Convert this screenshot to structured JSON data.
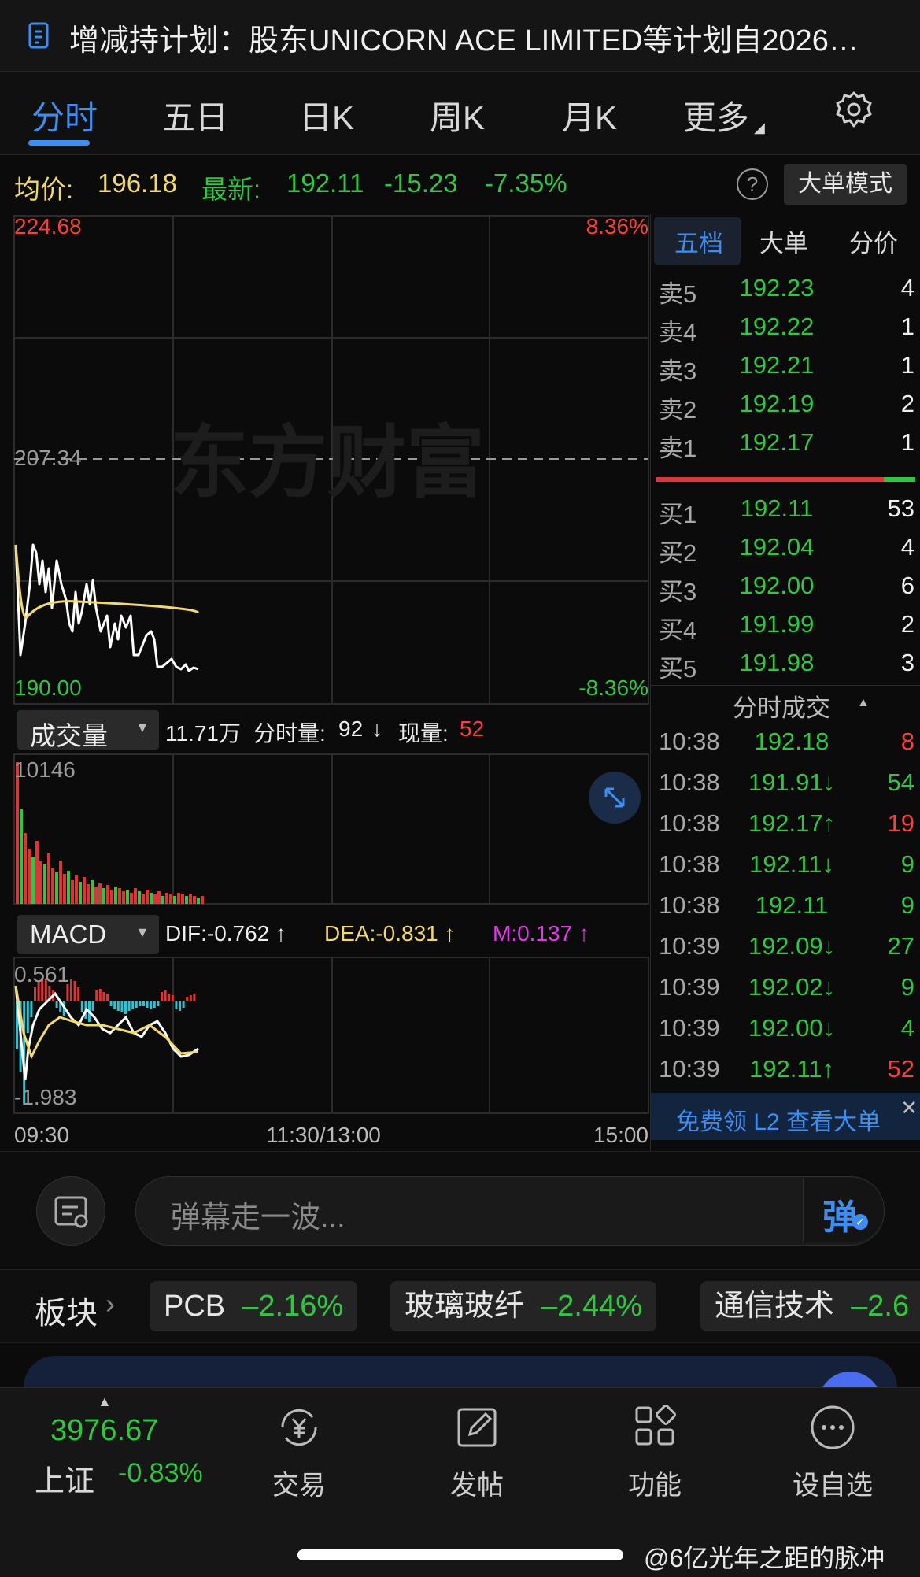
{
  "banner": {
    "text": "增减持计划：股东UNICORN ACE LIMITED等计划自2026…",
    "icon": "document-icon"
  },
  "tabs": [
    {
      "label": "分时",
      "active": true
    },
    {
      "label": "五日"
    },
    {
      "label": "日K"
    },
    {
      "label": "周K"
    },
    {
      "label": "月K"
    },
    {
      "label": "更多"
    }
  ],
  "settings_icon": "gear-icon",
  "info": {
    "avg_label": "均价:",
    "avg_value": "196.18",
    "latest_label": "最新:",
    "latest_value": "192.11",
    "change": "-15.23",
    "change_pct": "-7.35%",
    "help": "?",
    "big_order_mode": "大单模式"
  },
  "price_chart": {
    "high": "224.68",
    "high_pct": "8.36%",
    "prev_close": "207.34",
    "low": "190.00",
    "low_pct": "-8.36%",
    "watermark": "东方财富"
  },
  "volume": {
    "selector": "成交量",
    "total": "11.71万",
    "min_label": "分时量:",
    "min_value": "92",
    "min_arrow": "↓",
    "now_label": "现量:",
    "now_value": "52",
    "max": "10146"
  },
  "macd": {
    "selector": "MACD",
    "dif": "DIF:-0.762 ↑",
    "dea": "DEA:-0.831 ↑",
    "m": "M:0.137 ↑",
    "top": "0.561",
    "bottom": "-1.983"
  },
  "time_axis": [
    "09:30",
    "11:30/13:00",
    "15:00"
  ],
  "book": {
    "tabs": [
      "五档",
      "大单",
      "分价"
    ],
    "sells": [
      {
        "label": "卖5",
        "price": "192.23",
        "qty": "4"
      },
      {
        "label": "卖4",
        "price": "192.22",
        "qty": "1"
      },
      {
        "label": "卖3",
        "price": "192.21",
        "qty": "1"
      },
      {
        "label": "卖2",
        "price": "192.19",
        "qty": "2"
      },
      {
        "label": "卖1",
        "price": "192.17",
        "qty": "1"
      }
    ],
    "buys": [
      {
        "label": "买1",
        "price": "192.11",
        "qty": "53"
      },
      {
        "label": "买2",
        "price": "192.04",
        "qty": "4"
      },
      {
        "label": "买3",
        "price": "192.00",
        "qty": "6"
      },
      {
        "label": "买4",
        "price": "191.99",
        "qty": "2"
      },
      {
        "label": "买5",
        "price": "191.98",
        "qty": "3"
      }
    ],
    "trades_title": "分时成交",
    "trades": [
      {
        "time": "10:38",
        "price": "192.18",
        "vol": "8",
        "dir": "",
        "color": "red"
      },
      {
        "time": "10:38",
        "price": "191.91↓",
        "vol": "54",
        "dir": "down",
        "color": "green"
      },
      {
        "time": "10:38",
        "price": "192.17↑",
        "vol": "19",
        "dir": "up",
        "color": "red"
      },
      {
        "time": "10:38",
        "price": "192.11↓",
        "vol": "9",
        "dir": "down",
        "color": "green"
      },
      {
        "time": "10:38",
        "price": "192.11",
        "vol": "9",
        "dir": "",
        "color": "green"
      },
      {
        "time": "10:39",
        "price": "192.09↓",
        "vol": "27",
        "dir": "down",
        "color": "green"
      },
      {
        "time": "10:39",
        "price": "192.02↓",
        "vol": "9",
        "dir": "down",
        "color": "green"
      },
      {
        "time": "10:39",
        "price": "192.00↓",
        "vol": "4",
        "dir": "down",
        "color": "green"
      },
      {
        "time": "10:39",
        "price": "192.11↑",
        "vol": "52",
        "dir": "up",
        "color": "red"
      }
    ],
    "l2_banner": "免费领 L2 查看大单"
  },
  "comment": {
    "placeholder": "弹幕走一波...",
    "danmu_label": "弹"
  },
  "sectors": {
    "label": "板块",
    "items": [
      {
        "name": "PCB",
        "pct": "–2.16%"
      },
      {
        "name": "玻璃玻纤",
        "pct": "–2.44%"
      },
      {
        "name": "通信技术",
        "pct": "–2.6"
      }
    ]
  },
  "nav": {
    "index_value": "3976.67",
    "index_name": "上证",
    "index_pct": "-0.83%",
    "items": [
      {
        "label": "交易",
        "icon": "yuan-exchange-icon"
      },
      {
        "label": "发帖",
        "icon": "edit-post-icon"
      },
      {
        "label": "功能",
        "icon": "grid-apps-icon"
      },
      {
        "label": "设自选",
        "icon": "more-dots-icon"
      }
    ]
  },
  "watermark": "@6亿光年之距的脉冲",
  "colors": {
    "up": "#ff3b3b",
    "down": "#2ec840",
    "accent": "#3d8ef0",
    "avg_line": "#f2d96b"
  }
}
